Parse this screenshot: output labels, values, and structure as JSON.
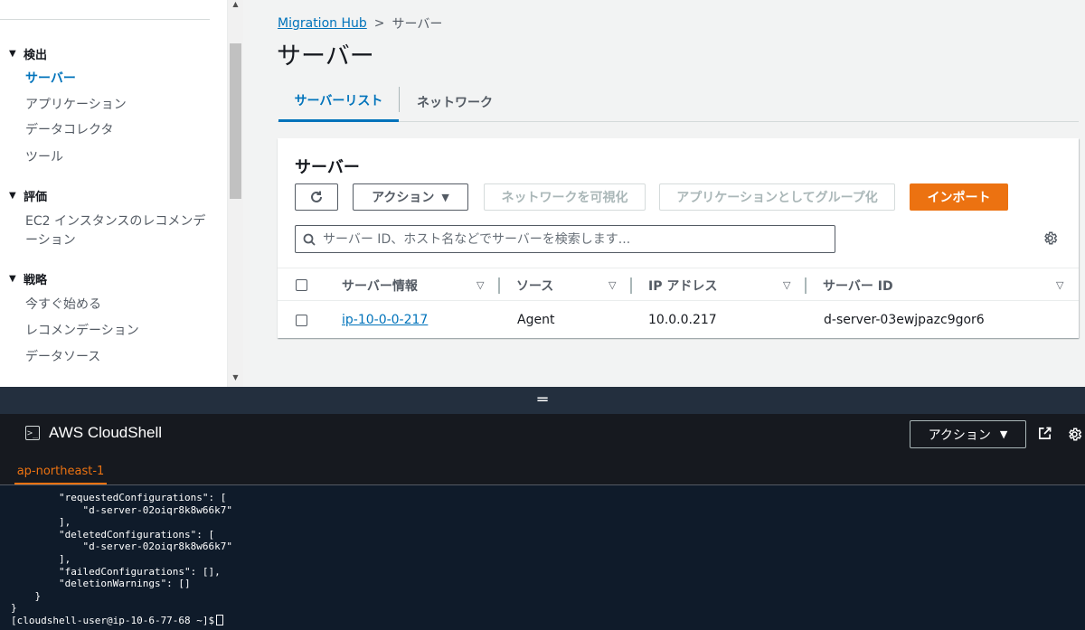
{
  "sidebar": {
    "sections": [
      {
        "title": "検出",
        "items": [
          "サーバー",
          "アプリケーション",
          "データコレクタ",
          "ツール"
        ]
      },
      {
        "title": "評価",
        "items": [
          "EC2 インスタンスのレコメンデ",
          "ーション"
        ]
      },
      {
        "title": "戦略",
        "items": [
          "今すぐ始める",
          "レコメンデーション",
          "データソース"
        ]
      }
    ],
    "active_item": "サーバー"
  },
  "breadcrumb": {
    "root": "Migration Hub",
    "current": "サーバー"
  },
  "page_title": "サーバー",
  "tabs": [
    {
      "label": "サーバーリスト",
      "active": true
    },
    {
      "label": "ネットワーク",
      "active": false
    }
  ],
  "panel": {
    "title": "サーバー",
    "buttons": {
      "refresh_icon": "refresh-icon",
      "action": "アクション",
      "visualize_network": "ネットワークを可視化",
      "group_as_app": "アプリケーションとしてグループ化",
      "import": "インポート"
    },
    "search_placeholder": "サーバー ID、ホスト名などでサーバーを検索します...",
    "columns": [
      "サーバー情報",
      "ソース",
      "IP アドレス",
      "サーバー ID"
    ],
    "rows": [
      {
        "server_info": "ip-10-0-0-217",
        "source": "Agent",
        "ip": "10.0.0.217",
        "server_id": "d-server-03ewjpazc9gor6"
      }
    ]
  },
  "cloudshell": {
    "title": "AWS CloudShell",
    "action": "アクション",
    "region_tab": "ap-northeast-1",
    "terminal_lines": [
      "        \"requestedConfigurations\": [",
      "            \"d-server-02oiqr8k8w66k7\"",
      "        ],",
      "        \"deletedConfigurations\": [",
      "            \"d-server-02oiqr8k8w66k7\"",
      "        ],",
      "        \"failedConfigurations\": [],",
      "        \"deletionWarnings\": []",
      "    }",
      "}"
    ],
    "prompt": "[cloudshell-user@ip-10-6-77-68 ~]$"
  },
  "colors": {
    "accent": "#0073bb",
    "primary_button": "#ec7211",
    "shell_bg": "#0f1b2a",
    "shell_header": "#16191f"
  }
}
